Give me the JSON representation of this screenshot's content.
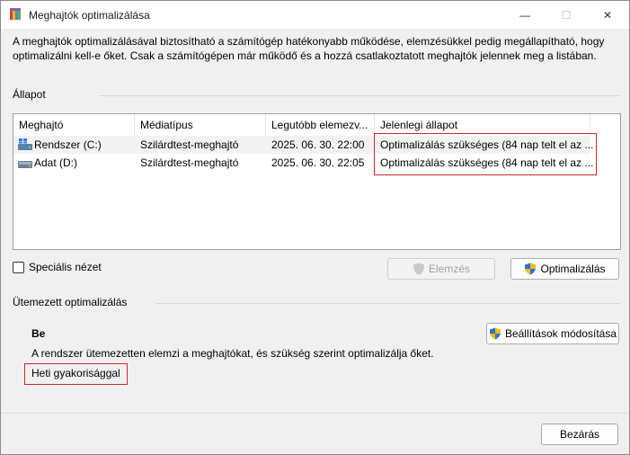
{
  "window": {
    "title": "Meghajtók optimalizálása",
    "min_glyph": "—",
    "max_glyph": "☐",
    "close_glyph": "✕"
  },
  "description": "A meghajtók optimalizálásával biztosítható a számítógép hatékonyabb működése, elemzésükkel pedig megállapítható, hogy optimalizálni kell-e őket. Csak a számítógépen már működő és a hozzá csatlakoztatott meghajtók jelennek meg a listában.",
  "status": {
    "label": "Állapot",
    "columns": [
      "Meghajtó",
      "Médiatípus",
      "Legutóbb elemezv...",
      "Jelenlegi állapot"
    ],
    "rows": [
      {
        "drive": "Rendszer (C:)",
        "icon": "windows-drive-icon",
        "media": "Szilárdtest-meghajtó",
        "last": "2025. 06. 30. 22:00",
        "state": "Optimalizálás szükséges (84 nap telt el az ..."
      },
      {
        "drive": "Adat (D:)",
        "icon": "drive-icon",
        "media": "Szilárdtest-meghajtó",
        "last": "2025. 06. 30. 22:05",
        "state": "Optimalizálás szükséges (84 nap telt el az ..."
      }
    ],
    "advanced_view": "Speciális nézet",
    "analyze_button": "Elemzés",
    "optimize_button": "Optimalizálás"
  },
  "scheduled": {
    "label": "Ütemezett optimalizálás",
    "state": "Be",
    "description": "A rendszer ütemezetten elemzi a meghajtókat, és szükség szerint optimalizálja őket.",
    "frequency": "Heti gyakorisággal",
    "change_settings_button": "Beállítások módosítása"
  },
  "close_button": "Bezárás",
  "colors": {
    "highlight": "#d0272f",
    "background": "#f0f0f0"
  }
}
